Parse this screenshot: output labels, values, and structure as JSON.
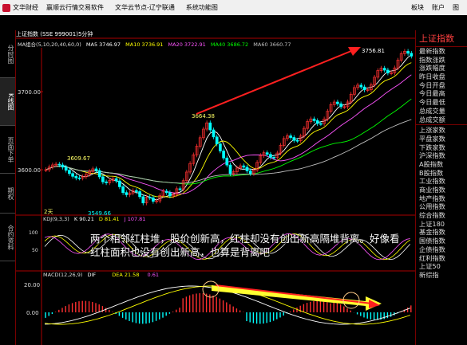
{
  "window": {
    "title": "文华财经",
    "menus": [
      "赢顺云行情交易软件",
      "文华云节点-辽宁联通",
      "系统功能图"
    ],
    "right_menu": [
      "板块",
      "账户",
      "图"
    ]
  },
  "left_tabs": [
    "分时图",
    "K线图",
    "页面下单",
    "期权",
    "合约资料"
  ],
  "header": {
    "instrument": "上证指数 (SSE 999001)5分钟"
  },
  "ma": {
    "label": "MA组合(5,10,20,40,60,0)",
    "items": [
      {
        "name": "MA5",
        "value": "3746.97",
        "color": "#ffffff"
      },
      {
        "name": "MA10",
        "value": "3736.91",
        "color": "#ffff00"
      },
      {
        "name": "MA20",
        "value": "3722.91",
        "color": "#ff55ff"
      },
      {
        "name": "MA40",
        "value": "3686.72",
        "color": "#00ff00"
      },
      {
        "name": "MA60",
        "value": "3660.77",
        "color": "#c0c0c0"
      }
    ]
  },
  "price_axis": [
    "3700.00",
    "3600.00"
  ],
  "price_annotations": {
    "high_right": "3756.81",
    "mid_high": "3664.38",
    "left_high": "3609.67",
    "low": "3549.66",
    "count_label": "2天"
  },
  "kdj": {
    "label": "KDJ(9,3,3)",
    "k_name": "K",
    "k_value": "90.21",
    "d_name": "D",
    "d_value": "81.41",
    "j_name": "J",
    "j_value": "107.81",
    "axis": [
      "100",
      "50"
    ]
  },
  "macd": {
    "label": "MACD(12,26,9)",
    "dif_name": "DIF",
    "dif_value": "",
    "dea_name": "DEA",
    "dea_value": "21.58",
    "macd_value": "0.61",
    "axis": [
      "20.00",
      "0.00"
    ]
  },
  "annotation_text": "两个相邻红柱堆，股价创新高，红柱却没有创出新高隔堆背离。好像看红柱面积也没有创出新高，也算是背离吧",
  "right_panel": {
    "title": "上证指数",
    "quote_items": [
      "最新指数",
      "指数涨跌",
      "涨跌幅度",
      "昨日收盘",
      "今日开盘",
      "今日最高",
      "今日最低",
      "总成交量",
      "总成交额"
    ],
    "index_items": [
      "上涨家数",
      "平盘家数",
      "下跌家数",
      "沪深指数",
      "A股指数",
      "B股指数",
      "工业指数",
      "商业指数",
      "地产指数",
      "公用指数",
      "综合指数",
      "上证180",
      "基金指数",
      "国债指数",
      "企债指数",
      "红利指数",
      "上证50",
      "新综指"
    ]
  },
  "colors": {
    "up": "#ff3030",
    "down": "#00ffff",
    "arrow_red": "#ff2020",
    "arrow_yellow": "#ffff30",
    "axis_red": "#aa0000"
  }
}
